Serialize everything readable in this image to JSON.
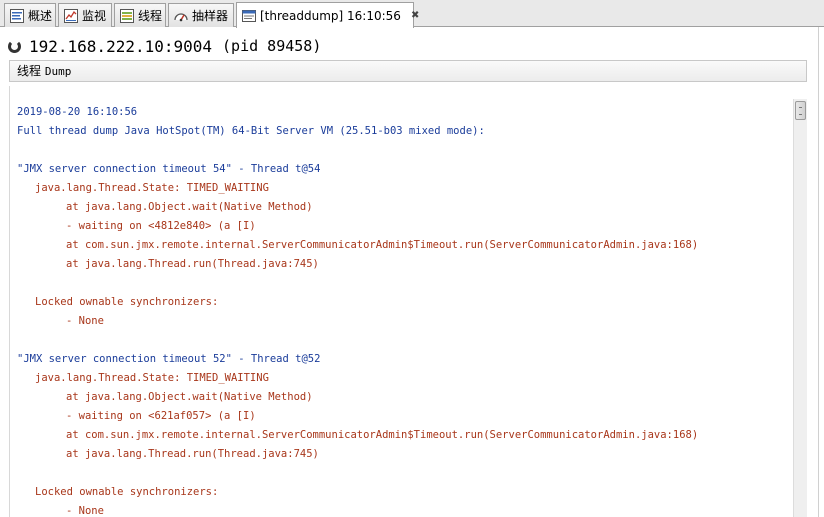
{
  "tabs": [
    {
      "label": "概述",
      "icon": "overview-icon"
    },
    {
      "label": "监视",
      "icon": "monitor-icon"
    },
    {
      "label": "线程",
      "icon": "threads-icon"
    },
    {
      "label": "抽样器",
      "icon": "sampler-icon"
    },
    {
      "label": "[threaddump] 16:10:56",
      "icon": "threaddump-icon",
      "close": "✖"
    }
  ],
  "header": {
    "host": "192.168.222.10:9004",
    "pid": "(pid 89458)"
  },
  "section": {
    "title_cn": "线程",
    "title_en": "Dump"
  },
  "dump_lines": [
    {
      "text": "2019-08-20 16:10:56",
      "color": "blue"
    },
    {
      "text": "Full thread dump Java HotSpot(TM) 64-Bit Server VM (25.51-b03 mixed mode):",
      "color": "blue"
    },
    {
      "text": "\"JMX server connection timeout 54\" - Thread t@54",
      "color": "blue"
    },
    {
      "text": "java.lang.Thread.State: TIMED_WAITING",
      "color": "red"
    },
    {
      "text": "at java.lang.Object.wait(Native Method)",
      "color": "red"
    },
    {
      "text": "- waiting on <4812e840> (a [I)",
      "color": "red"
    },
    {
      "text": "at com.sun.jmx.remote.internal.ServerCommunicatorAdmin$Timeout.run(ServerCommunicatorAdmin.java:168)",
      "color": "red"
    },
    {
      "text": "at java.lang.Thread.run(Thread.java:745)",
      "color": "red"
    },
    {
      "text": "Locked ownable synchronizers:",
      "color": "red"
    },
    {
      "text": "- None",
      "color": "red"
    },
    {
      "text": "\"JMX server connection timeout 52\" - Thread t@52",
      "color": "blue"
    },
    {
      "text": "java.lang.Thread.State: TIMED_WAITING",
      "color": "red"
    },
    {
      "text": "at java.lang.Object.wait(Native Method)",
      "color": "red"
    },
    {
      "text": "- waiting on <621af057> (a [I)",
      "color": "red"
    },
    {
      "text": "at com.sun.jmx.remote.internal.ServerCommunicatorAdmin$Timeout.run(ServerCommunicatorAdmin.java:168)",
      "color": "red"
    },
    {
      "text": "at java.lang.Thread.run(Thread.java:745)",
      "color": "red"
    },
    {
      "text": "Locked ownable synchronizers:",
      "color": "red"
    },
    {
      "text": "- None",
      "color": "red"
    }
  ],
  "colors": {
    "blue_text": "#1a3c9a",
    "red_text": "#a8361a"
  }
}
